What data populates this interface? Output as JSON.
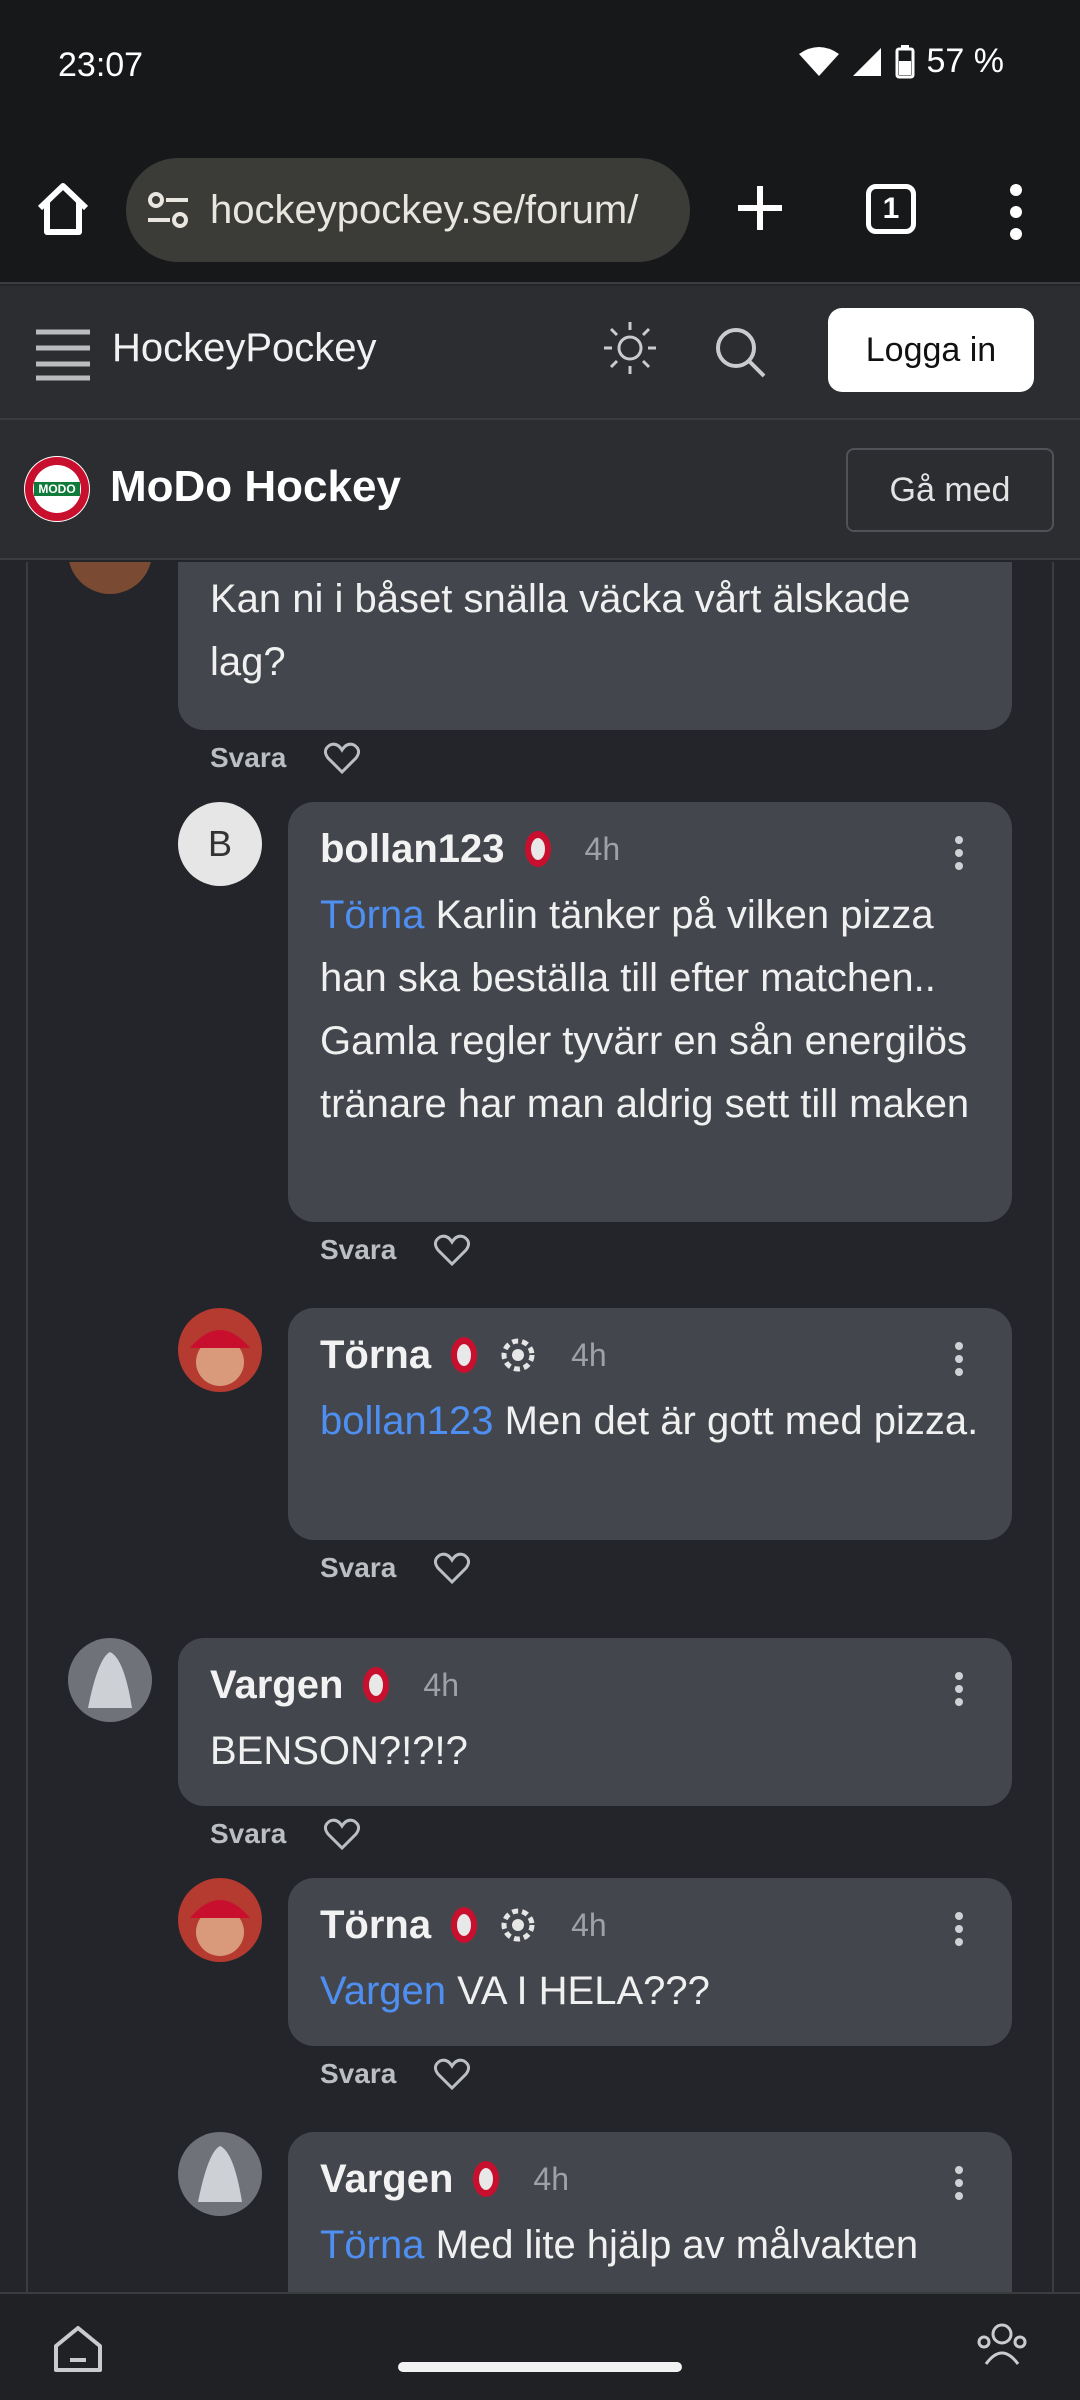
{
  "status_bar": {
    "time": "23:07",
    "battery": "57 %"
  },
  "browser": {
    "url": "hockeypockey.se/forum/",
    "tab_count": "1"
  },
  "site": {
    "brand": "HockeyPockey",
    "login_label": "Logga in"
  },
  "club": {
    "name": "MoDo Hockey",
    "join_label": "Gå med"
  },
  "comments": [
    {
      "id": "c0",
      "user": "",
      "time": "",
      "text": "Kan ni i båset snälla väcka vårt älskade lag?",
      "reply_label": "Svara"
    },
    {
      "id": "c1",
      "user": "bollan123",
      "avatar_letter": "B",
      "time": "4h",
      "mention": "Törna",
      "text": "Karlin tänker på vilken pizza han ska beställa till efter matchen.. Gamla regler tyvärr en sån energilös tränare har man aldrig sett till maken",
      "reply_label": "Svara"
    },
    {
      "id": "c2",
      "user": "Törna",
      "time": "4h",
      "mention": "bollan123",
      "text": "Men det är gott med pizza.",
      "reply_label": "Svara"
    },
    {
      "id": "c3",
      "user": "Vargen",
      "time": "4h",
      "text": "BENSON?!?!?",
      "reply_label": "Svara"
    },
    {
      "id": "c4",
      "user": "Törna",
      "time": "4h",
      "mention": "Vargen",
      "text": "VA I HELA???",
      "reply_label": "Svara"
    },
    {
      "id": "c5",
      "user": "Vargen",
      "time": "4h",
      "mention": "Törna",
      "text": "Med lite hjälp av målvakten"
    }
  ],
  "colors": {
    "background": "#23252a",
    "bubble": "#43464d",
    "mention": "#4f8ff2",
    "header": "#2b2d31"
  }
}
